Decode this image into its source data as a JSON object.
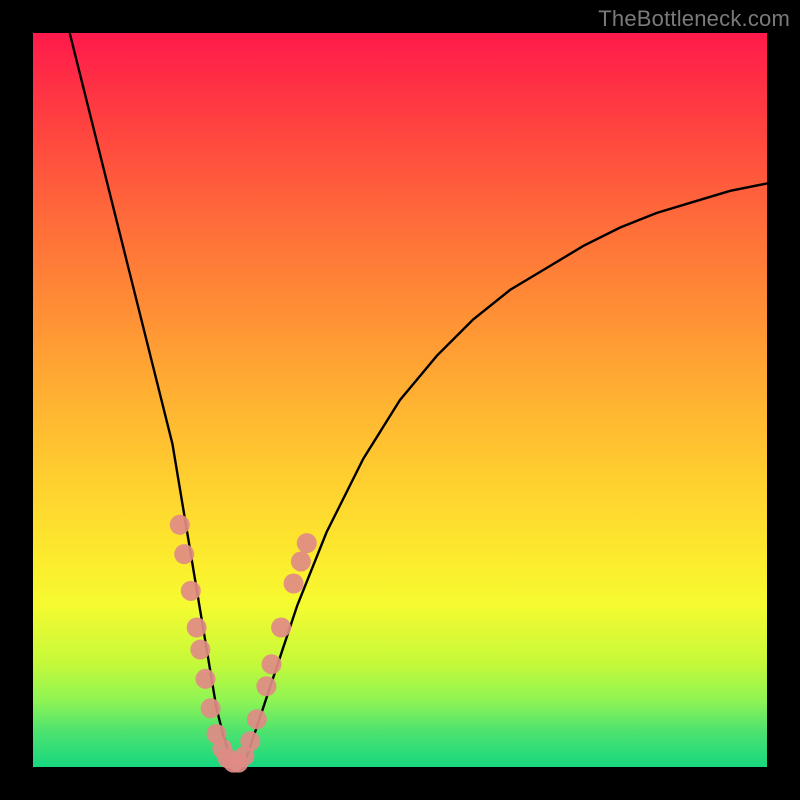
{
  "watermark": "TheBottleneck.com",
  "colors": {
    "background": "#000000",
    "gradient_top": "#ff1a4b",
    "gradient_bottom": "#17d77f",
    "curve": "#000000",
    "dots": "#e08b85"
  },
  "chart_data": {
    "type": "line",
    "title": "",
    "xlabel": "",
    "ylabel": "",
    "xlim": [
      0,
      100
    ],
    "ylim": [
      0,
      100
    ],
    "annotations": [],
    "series": [
      {
        "name": "bottleneck-curve",
        "x": [
          5,
          7,
          9,
          11,
          13,
          15,
          17,
          19,
          20,
          21,
          22,
          23,
          24,
          25,
          26,
          27,
          28,
          29,
          30,
          32,
          34,
          36,
          40,
          45,
          50,
          55,
          60,
          65,
          70,
          75,
          80,
          85,
          90,
          95,
          100
        ],
        "y": [
          100,
          92,
          84,
          76,
          68,
          60,
          52,
          44,
          38,
          32,
          26,
          20,
          14,
          8,
          4,
          1,
          0,
          1,
          4,
          10,
          16,
          22,
          32,
          42,
          50,
          56,
          61,
          65,
          68,
          71,
          73.5,
          75.5,
          77,
          78.5,
          79.5
        ]
      }
    ],
    "scatter_overlay": {
      "name": "highlight-dots",
      "points": [
        {
          "x": 20.0,
          "y": 33
        },
        {
          "x": 20.6,
          "y": 29
        },
        {
          "x": 21.5,
          "y": 24
        },
        {
          "x": 22.3,
          "y": 19
        },
        {
          "x": 22.8,
          "y": 16
        },
        {
          "x": 23.5,
          "y": 12
        },
        {
          "x": 24.2,
          "y": 8
        },
        {
          "x": 25.0,
          "y": 4.5
        },
        {
          "x": 25.8,
          "y": 2.5
        },
        {
          "x": 26.5,
          "y": 1.2
        },
        {
          "x": 27.3,
          "y": 0.6
        },
        {
          "x": 28.0,
          "y": 0.6
        },
        {
          "x": 28.8,
          "y": 1.5
        },
        {
          "x": 29.6,
          "y": 3.5
        },
        {
          "x": 30.5,
          "y": 6.5
        },
        {
          "x": 31.8,
          "y": 11
        },
        {
          "x": 32.5,
          "y": 14
        },
        {
          "x": 33.8,
          "y": 19
        },
        {
          "x": 35.5,
          "y": 25
        },
        {
          "x": 36.5,
          "y": 28
        },
        {
          "x": 37.3,
          "y": 30.5
        }
      ],
      "radius_px": 10
    }
  }
}
